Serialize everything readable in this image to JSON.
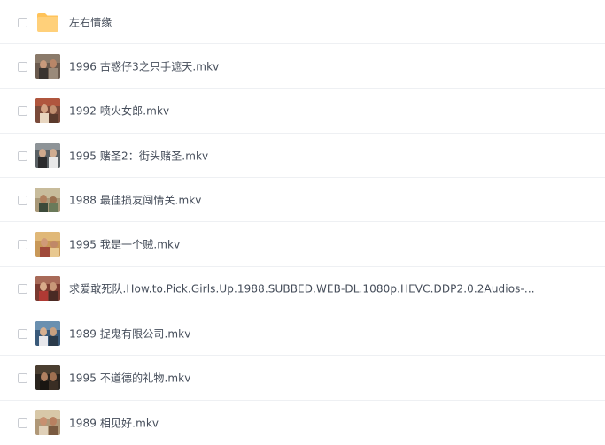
{
  "files": [
    {
      "name": "左右情缘",
      "type": "folder",
      "icon": "folder-icon"
    },
    {
      "name": "1996 古惑仔3之只手遮天.mkv",
      "type": "video",
      "icon": "video-thumbnail-icon"
    },
    {
      "name": "1992 喷火女郎.mkv",
      "type": "video",
      "icon": "video-thumbnail-icon"
    },
    {
      "name": "1995 赌圣2：街头赌圣.mkv",
      "type": "video",
      "icon": "video-thumbnail-icon"
    },
    {
      "name": "1988 最佳损友闯情关.mkv",
      "type": "video",
      "icon": "video-thumbnail-icon"
    },
    {
      "name": "1995 我是一个贼.mkv",
      "type": "video",
      "icon": "video-thumbnail-icon"
    },
    {
      "name": "求爱敢死队.How.to.Pick.Girls.Up.1988.SUBBED.WEB-DL.1080p.HEVC.DDP2.0.2Audios-...",
      "type": "video",
      "icon": "video-thumbnail-icon"
    },
    {
      "name": "1989 捉鬼有限公司.mkv",
      "type": "video",
      "icon": "video-thumbnail-icon"
    },
    {
      "name": "1995 不道德的礼物.mkv",
      "type": "video",
      "icon": "video-thumbnail-icon"
    },
    {
      "name": "1989 相见好.mkv",
      "type": "video",
      "icon": "video-thumbnail-icon"
    }
  ],
  "colors": {
    "folder": "#ffd07a",
    "folder_tab": "#ffc35a",
    "text": "#454d5a",
    "divider": "#eef0f3",
    "checkbox_border": "#c9ccd2"
  }
}
